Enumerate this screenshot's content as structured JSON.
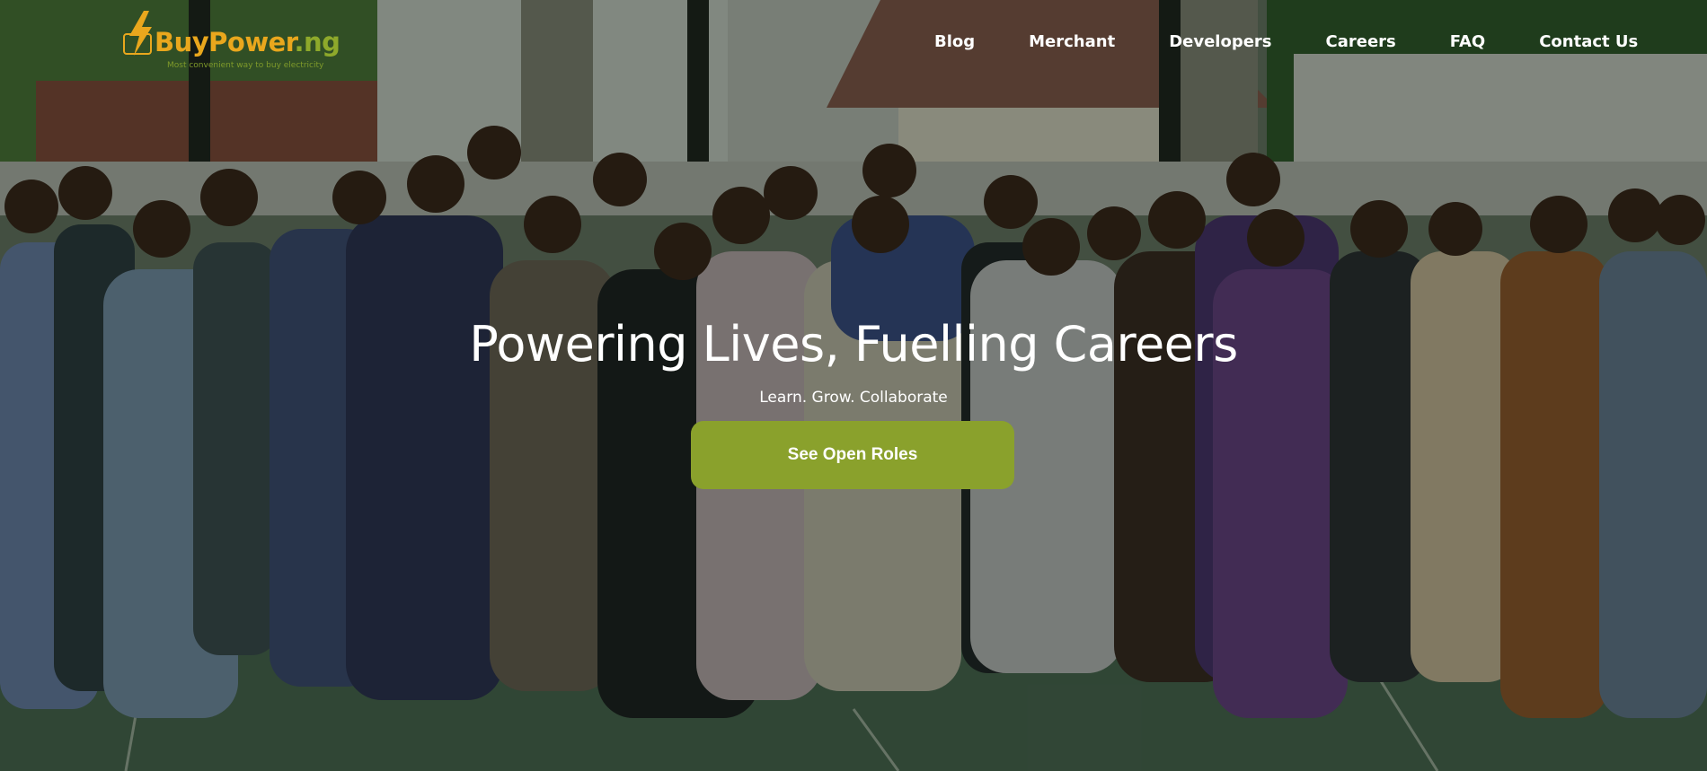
{
  "brand": {
    "name_main": "BuyPower",
    "name_tld": ".ng",
    "tagline": "Most convenient way to buy electricity",
    "primary_color": "#e9a71d",
    "accent_color": "#8aa12c"
  },
  "nav": {
    "items": [
      {
        "label": "Blog"
      },
      {
        "label": "Merchant"
      },
      {
        "label": "Developers"
      },
      {
        "label": "Careers"
      },
      {
        "label": "FAQ"
      },
      {
        "label": "Contact Us"
      }
    ]
  },
  "hero": {
    "title": "Powering Lives, Fuelling Careers",
    "subtitle": "Learn. Grow. Collaborate",
    "cta_label": "See Open Roles",
    "background": "team-group-photo"
  }
}
